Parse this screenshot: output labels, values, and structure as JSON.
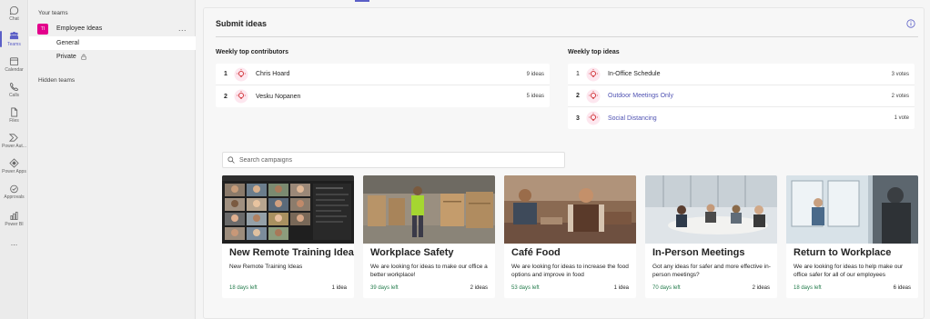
{
  "rail": [
    {
      "label": "Chat",
      "icon": "chat-icon"
    },
    {
      "label": "Teams",
      "icon": "teams-icon",
      "active": true
    },
    {
      "label": "Calendar",
      "icon": "calendar-icon"
    },
    {
      "label": "Calls",
      "icon": "phone-icon"
    },
    {
      "label": "Files",
      "icon": "file-icon"
    },
    {
      "label": "Power Aut...",
      "icon": "power-automate-icon"
    },
    {
      "label": "Power Apps",
      "icon": "power-apps-icon"
    },
    {
      "label": "Approvals",
      "icon": "approvals-icon"
    },
    {
      "label": "Power BI",
      "icon": "power-bi-icon"
    },
    {
      "label": "...",
      "icon": "more-icon"
    }
  ],
  "teams_panel": {
    "your_teams": "Your teams",
    "team": {
      "avatar": "TI",
      "name": "Employee Ideas",
      "more": "..."
    },
    "channels": [
      {
        "label": "General",
        "selected": true
      },
      {
        "label": "Private",
        "locked": true
      }
    ],
    "hidden_teams": "Hidden teams"
  },
  "page": {
    "title": "Submit ideas"
  },
  "contributors": {
    "label": "Weekly top contributors",
    "rows": [
      {
        "rank": "1",
        "name": "Chris Hoard",
        "count": "9 ideas"
      },
      {
        "rank": "2",
        "name": "Vesku Nopanen",
        "count": "5 ideas"
      }
    ]
  },
  "top_ideas": {
    "label": "Weekly top ideas",
    "rows": [
      {
        "rank": "1",
        "name": "In-Office Schedule",
        "count": "3 votes"
      },
      {
        "rank": "2",
        "name": "Outdoor Meetings Only",
        "count": "2 votes"
      },
      {
        "rank": "3",
        "name": "Social Distancing",
        "count": "1 vote"
      }
    ]
  },
  "search": {
    "placeholder": "Search campaigns"
  },
  "campaigns": [
    {
      "title": "New Remote Training Ideas",
      "description": "New Remote Training Ideas",
      "days_left": "18 days left",
      "count": "1 idea"
    },
    {
      "title": "Workplace Safety",
      "description": "We are looking for ideas to make our office a better workplace!",
      "days_left": "39 days left",
      "count": "2 ideas"
    },
    {
      "title": "Café Food",
      "description": "We are looking for ideas to increase the food options and improve in food",
      "days_left": "53 days left",
      "count": "1 idea"
    },
    {
      "title": "In-Person Meetings",
      "description": "Got any ideas for safer and more effective in-person meetings?",
      "days_left": "70 days left",
      "count": "2 ideas"
    },
    {
      "title": "Return to Workplace",
      "description": "We are looking for ideas to help make our office safer for all of our employees",
      "days_left": "18 days left",
      "count": "6 ideas"
    }
  ],
  "colors": {
    "accent": "#5b5fc7",
    "team_avatar": "#e3008c",
    "days_left": "#237b4b",
    "idea_link": "#4f52b2"
  }
}
